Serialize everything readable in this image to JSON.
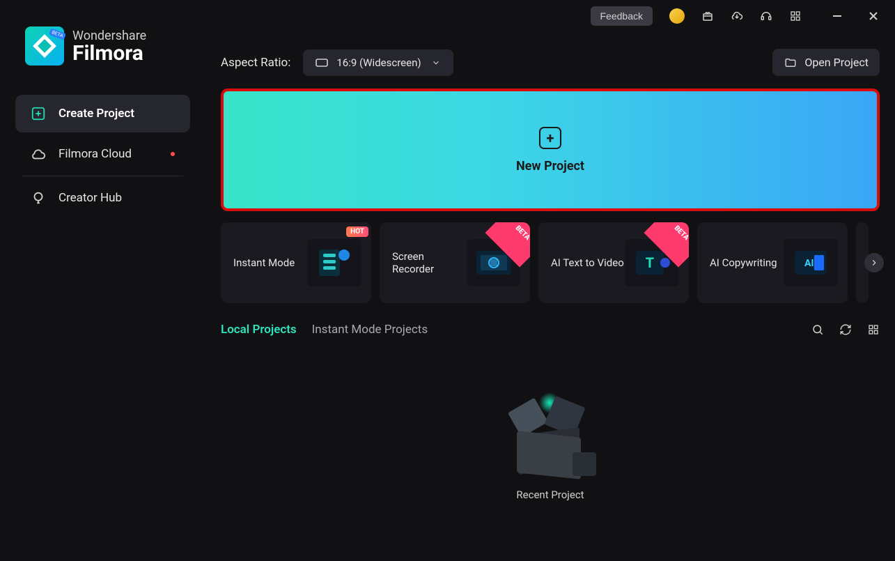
{
  "brand": {
    "top": "Wondershare",
    "main": "Filmora",
    "badge": "BETA"
  },
  "sidebar": {
    "items": [
      {
        "label": "Create Project"
      },
      {
        "label": "Filmora Cloud"
      },
      {
        "label": "Creator Hub"
      }
    ]
  },
  "titlebar": {
    "feedback": "Feedback"
  },
  "toolbar": {
    "aspect_label": "Aspect Ratio:",
    "aspect_value": "16:9 (Widescreen)",
    "open_project": "Open Project"
  },
  "new_project": {
    "label": "New Project"
  },
  "cards": [
    {
      "label": "Instant Mode",
      "badge": "HOT"
    },
    {
      "label": "Screen Recorder",
      "badge": "BETA"
    },
    {
      "label": "AI Text to Video",
      "badge": "BETA"
    },
    {
      "label": "AI Copywriting",
      "badge": ""
    }
  ],
  "tabs": {
    "local": "Local Projects",
    "instant": "Instant Mode Projects"
  },
  "empty": {
    "label": "Recent Project"
  }
}
